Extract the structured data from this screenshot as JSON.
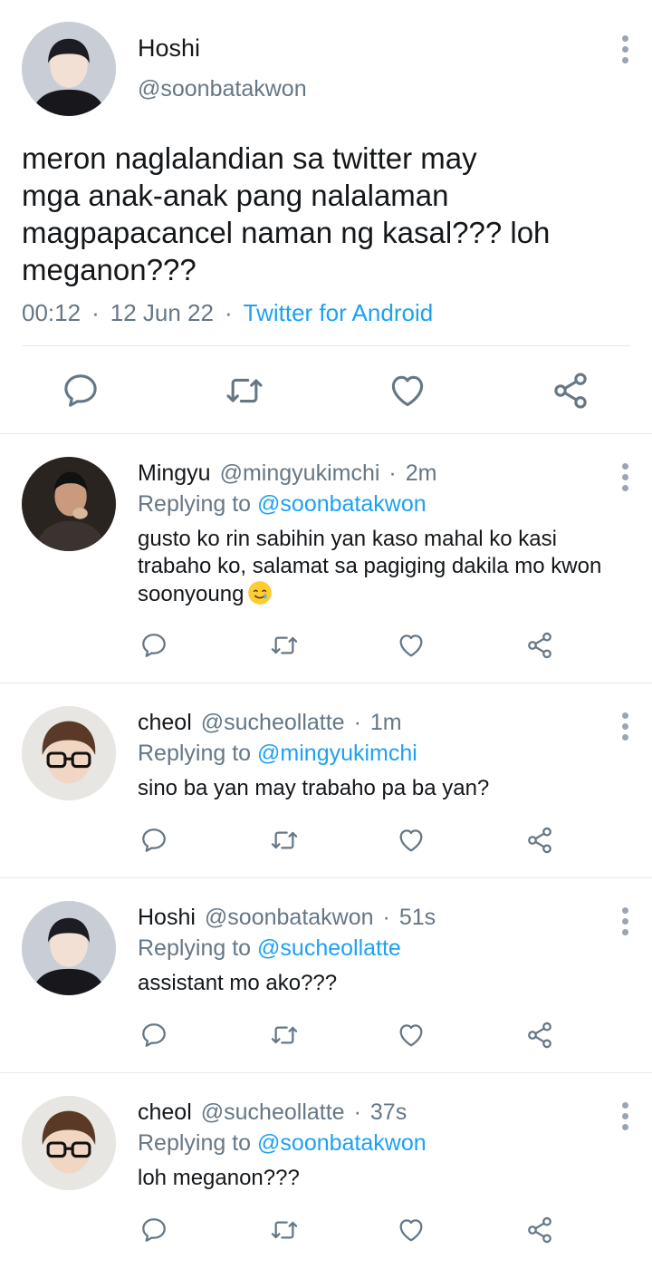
{
  "main": {
    "name": "Hoshi",
    "handle": "@soonbatakwon",
    "text": "meron naglalandian sa twitter may\nmga anak-anak pang nalalaman\nmagpapacancel naman ng kasal??? loh\nmeganon???",
    "time": "00:12",
    "separator": "·",
    "date": "12 Jun 22",
    "source": "Twitter for Android"
  },
  "replies": [
    {
      "name": "Mingyu",
      "handle": "@mingyukimchi",
      "time": "2m",
      "replying_prefix": "Replying to",
      "replying_to": "@soonbatakwon",
      "text": "gusto ko rin sabihin yan kaso mahal ko kasi trabaho ko, salamat sa pagiging dakila mo kwon soonyoung",
      "emoji": "smiling-face-with-tear"
    },
    {
      "name": "cheol",
      "handle": "@sucheollatte",
      "time": "1m",
      "replying_prefix": "Replying to",
      "replying_to": "@mingyukimchi",
      "text": "sino ba yan may trabaho pa ba yan?"
    },
    {
      "name": "Hoshi",
      "handle": "@soonbatakwon",
      "time": "51s",
      "replying_prefix": "Replying to",
      "replying_to": "@sucheollatte",
      "text": "assistant mo ako???"
    },
    {
      "name": "cheol",
      "handle": "@sucheollatte",
      "time": "37s",
      "replying_prefix": "Replying to",
      "replying_to": "@soonbatakwon",
      "text": "loh meganon???"
    }
  ],
  "icons": {
    "reply": "reply-icon",
    "retweet": "retweet-icon",
    "like": "heart-icon",
    "share": "share-icon",
    "more": "more-vertical-icon"
  },
  "colors": {
    "accent": "#1da1f2",
    "icon": "#657786",
    "text": "#14171a",
    "divider": "#e1e8ed"
  }
}
